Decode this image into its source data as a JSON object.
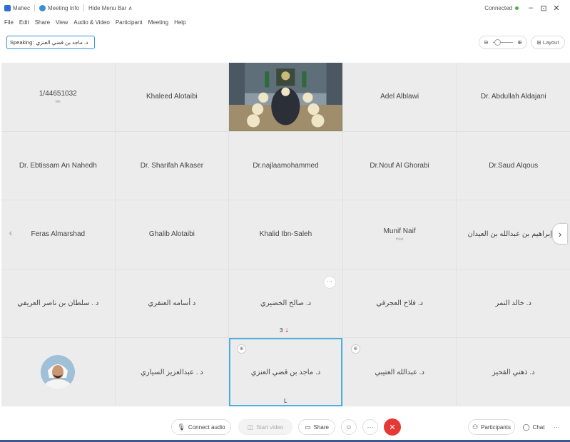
{
  "titlebar": {
    "app": "Mahec",
    "meeting_info": "Meeting Info",
    "hide_menu": "Hide Menu Bar ∧",
    "status": "Connected",
    "minimize": "–",
    "maximize": "⊡",
    "close": "✕"
  },
  "menu": [
    "File",
    "Edit",
    "Share",
    "View",
    "Audio & Video",
    "Participant",
    "Meeting",
    "Help"
  ],
  "speaking": {
    "label": "Speaking:",
    "name": "د. ماجد بن قضي العنزي"
  },
  "view": {
    "zoom_out": "⊖",
    "zoom_in": "⊕",
    "layout_label": "⊞ Layout"
  },
  "tiles": [
    {
      "name": "1/44651032",
      "sub": "Me"
    },
    {
      "name": "Khaleed Alotaibi"
    },
    {
      "name": ""
    },
    {
      "name": "Adel Alblawi"
    },
    {
      "name": "Dr. Abdullah Aldajani"
    },
    {
      "name": "Dr. Ebtissam An Nahedh"
    },
    {
      "name": "Dr. Sharifah Alkaser"
    },
    {
      "name": "Dr.najlaamohammed"
    },
    {
      "name": "Dr.Nouf Al Ghorabi"
    },
    {
      "name": "Dr.Saud Alqous"
    },
    {
      "name": "Feras Almarshad"
    },
    {
      "name": "Ghalib Alotaibi"
    },
    {
      "name": "Khalid Ibn-Saleh"
    },
    {
      "name": "Munif Naif",
      "sub": "Host"
    },
    {
      "name": "د. إبراهيم بن عبدالله بن العيدان"
    },
    {
      "name": "د . سلطان بن ناصر العريفي"
    },
    {
      "name": "د أسامه العنقري"
    },
    {
      "name": "د. صالح الخضيري"
    },
    {
      "name": "د. فلاح العجرفي"
    },
    {
      "name": "د. خالد النمر"
    },
    {
      "name": ""
    },
    {
      "name": "د . عبدالعزيز السياري"
    },
    {
      "name": "د. ماجد بن قضي العنزي"
    },
    {
      "name": "د. عبدالله العتيبي"
    },
    {
      "name": "د. ذهني القحيز"
    }
  ],
  "floating": {
    "count_label": "3",
    "letter_label": "L"
  },
  "icons": {
    "more": "···",
    "mic_small": "⊕",
    "nav_left": "‹",
    "nav_right": "›"
  },
  "toolbar": {
    "connect_audio": "Connect audio",
    "start_video": "Start video",
    "share": "Share",
    "more": "···",
    "participants": "Participants",
    "chat": "Chat",
    "chat_more": "···"
  },
  "colors": {
    "accent": "#4fb0e0",
    "hangup": "#e53935",
    "connected": "#4caf50"
  }
}
